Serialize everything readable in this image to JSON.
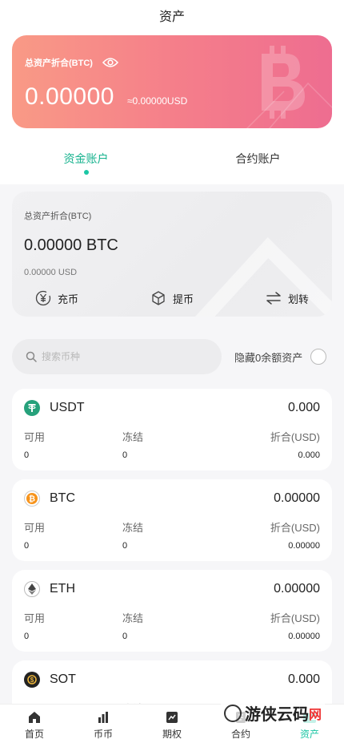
{
  "header": {
    "title": "资产"
  },
  "hero": {
    "label": "总资产折合(BTC)",
    "amount": "0.00000",
    "usd": "≈0.00000USD"
  },
  "tabs": [
    {
      "label": "资金账户",
      "active": true
    },
    {
      "label": "合约账户",
      "active": false
    }
  ],
  "account": {
    "label": "总资产折合(BTC)",
    "btc": "0.00000 BTC",
    "usd": "0.00000 USD",
    "actions": [
      {
        "label": "充币",
        "icon": "yen-icon"
      },
      {
        "label": "提币",
        "icon": "cube-icon"
      },
      {
        "label": "划转",
        "icon": "transfer-icon"
      }
    ]
  },
  "search": {
    "placeholder": "搜索币种",
    "hide_zero_label": "隐藏0余额资产"
  },
  "columns": {
    "available": "可用",
    "frozen": "冻结",
    "value_usd": "折合(USD)"
  },
  "coins": [
    {
      "name": "USDT",
      "total": "0.000",
      "available": "0",
      "frozen": "0",
      "usd": "0.000",
      "color": "#26a17b",
      "icon": "tether-icon"
    },
    {
      "name": "BTC",
      "total": "0.00000",
      "available": "0",
      "frozen": "0",
      "usd": "0.00000",
      "color": "#f7931a",
      "icon": "bitcoin-icon"
    },
    {
      "name": "ETH",
      "total": "0.00000",
      "available": "0",
      "frozen": "0",
      "usd": "0.00000",
      "color": "#555555",
      "icon": "ethereum-icon"
    },
    {
      "name": "SOT",
      "total": "0.000",
      "available": "",
      "frozen": "",
      "usd": "",
      "color": "#222222",
      "icon": "sot-icon"
    }
  ],
  "tabbar": [
    {
      "label": "首页",
      "icon": "home-icon",
      "active": false
    },
    {
      "label": "币币",
      "icon": "bar-chart-icon",
      "active": false
    },
    {
      "label": "期权",
      "icon": "options-icon",
      "active": false
    },
    {
      "label": "合约",
      "icon": "contract-icon",
      "active": false
    },
    {
      "label": "资产",
      "icon": "wallet-icon",
      "active": true
    }
  ],
  "watermark": {
    "text": "游侠云码",
    "mark": "网"
  },
  "colors": {
    "accent": "#1bc6a4",
    "hero_start": "#f99a86",
    "hero_end": "#ee6d90"
  }
}
